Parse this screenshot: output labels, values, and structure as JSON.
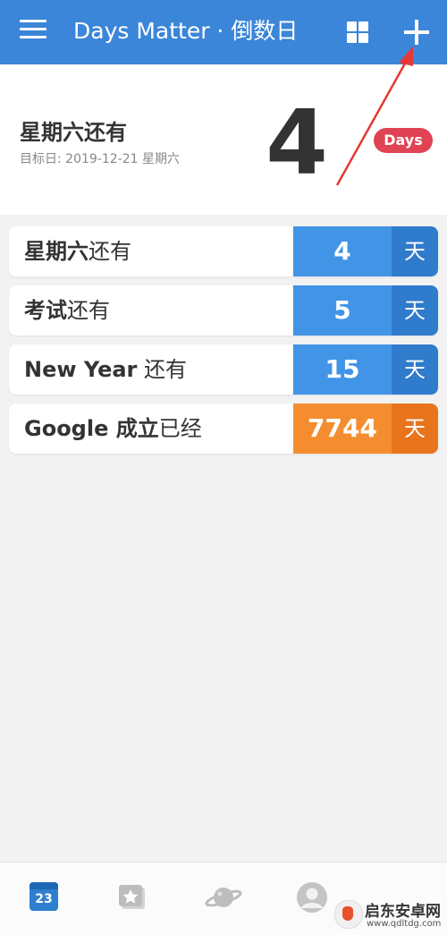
{
  "header": {
    "title": "Days Matter · 倒数日",
    "menu_icon": "menu-icon",
    "grid_icon": "grid-view-icon",
    "add_icon": "plus-icon",
    "background_color": "#3b86d8"
  },
  "featured": {
    "title": "星期六还有",
    "target_date": "目标日: 2019-12-21 星期六",
    "days": "4",
    "unit_badge": "Days",
    "badge_color": "#e04353"
  },
  "events": [
    {
      "name_bold": "星期六",
      "suffix": "还有",
      "count": "4",
      "unit": "天",
      "color": "blue"
    },
    {
      "name_bold": "考试",
      "suffix": "还有",
      "count": "5",
      "unit": "天",
      "color": "blue"
    },
    {
      "name_bold": "New Year",
      "suffix": " 还有",
      "count": "15",
      "unit": "天",
      "color": "blue"
    },
    {
      "name_bold": "Google 成立",
      "suffix": "已经",
      "count": "7744",
      "unit": "天",
      "color": "orange"
    }
  ],
  "bottom_nav": {
    "items": [
      {
        "icon": "calendar-icon",
        "text": "23",
        "active": true
      },
      {
        "icon": "star-card-icon"
      },
      {
        "icon": "planet-icon"
      },
      {
        "icon": "avatar-icon"
      }
    ]
  },
  "colors": {
    "future_count": "#4294e6",
    "past_count": "#f48d2f",
    "annotation_arrow": "#e53935"
  },
  "watermark": {
    "title": "启东安卓网",
    "url": "www.qdltdg.com"
  }
}
